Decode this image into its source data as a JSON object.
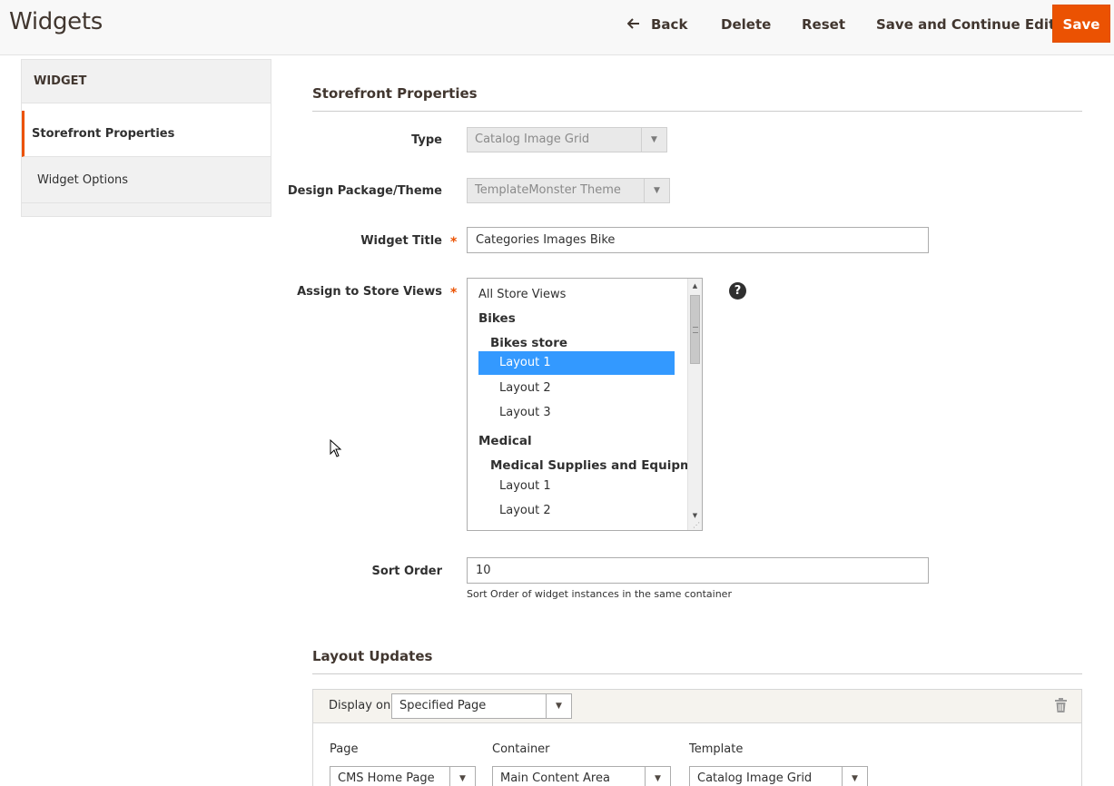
{
  "header": {
    "title": "Widgets",
    "back_label": "Back",
    "delete_label": "Delete",
    "reset_label": "Reset",
    "save_continue_label": "Save and Continue Edit",
    "save_label": "Save"
  },
  "sidebar": {
    "title": "WIDGET",
    "items": [
      {
        "label": "Storefront Properties",
        "active": true
      },
      {
        "label": "Widget Options",
        "active": false
      }
    ]
  },
  "storefront": {
    "section_title": "Storefront Properties",
    "type_label": "Type",
    "type_value": "Catalog Image Grid",
    "theme_label": "Design Package/Theme",
    "theme_value": "TemplateMonster Theme",
    "widget_title_label": "Widget Title",
    "widget_title_value": "Categories Images Bike",
    "store_views_label": "Assign to Store Views",
    "required_mark": "*",
    "store_views": {
      "all": "All Store Views",
      "website_1": "Bikes",
      "store_1": "Bikes store",
      "view_1": "Layout 1",
      "view_2": "Layout 2",
      "view_3": "Layout 3",
      "website_2": "Medical",
      "store_2": "Medical Supplies and Equipment",
      "view_4": "Layout 1",
      "view_5": "Layout 2",
      "selected": "Layout 1"
    },
    "help_icon": "?",
    "sort_order_label": "Sort Order",
    "sort_order_value": "10",
    "sort_order_note": "Sort Order of widget instances in the same container"
  },
  "layout_updates": {
    "section_title": "Layout Updates",
    "display_on_label": "Display on",
    "display_on_value": "Specified Page",
    "page_label": "Page",
    "page_value": "CMS Home Page",
    "container_label": "Container",
    "container_value": "Main Content Area",
    "template_label": "Template",
    "template_value": "Catalog Image Grid"
  },
  "colors": {
    "accent": "#eb5202",
    "selection": "#3399ff"
  }
}
